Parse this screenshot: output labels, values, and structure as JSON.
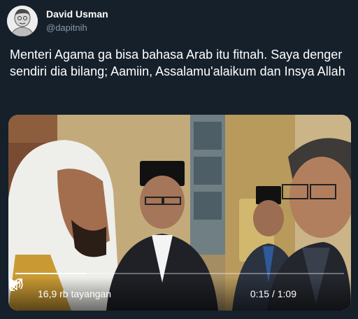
{
  "author": {
    "name": "David Usman",
    "handle": "@dapitnih",
    "avatar_icon": "user-avatar-icon"
  },
  "tweet": {
    "text": "Menteri Agama ga bisa bahasa Arab itu fitnah. Saya denger sendiri dia bilang; Aamiin, Assalamu'alaikum dan Insya Allah"
  },
  "video": {
    "views_label": "16,9 rb tayangan",
    "time_label": "0:15 / 1:09",
    "progress_fraction": 0.217,
    "play_icon": "play-icon",
    "volume_icon": "volume-icon",
    "fullscreen_icon": "fullscreen-icon"
  },
  "colors": {
    "background": "#15202b",
    "secondary_text": "#8b98a5"
  }
}
